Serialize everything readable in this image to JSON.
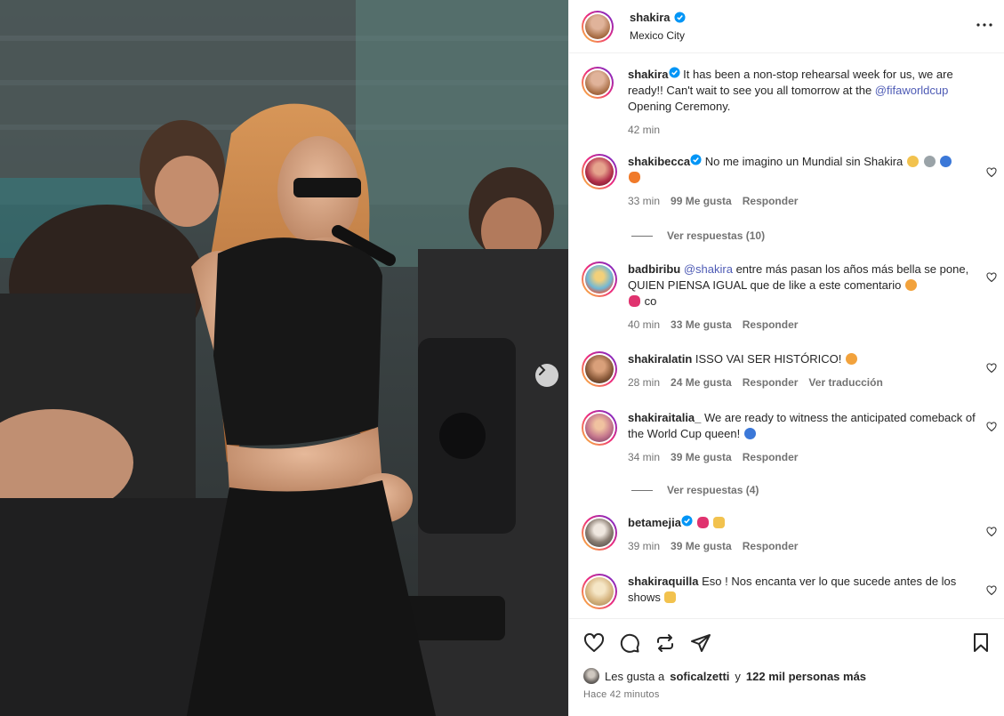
{
  "post": {
    "author": "shakira",
    "location": "Mexico City",
    "caption_text": "It has been a non-stop rehearsal week for us, we are ready!! Can't wait to see you all tomorrow at the",
    "caption_mention": "@fifaworldcup",
    "caption_end": "Opening Ceremony.",
    "caption_time": "42 min"
  },
  "comments": [
    {
      "user": "shakibecca",
      "verified": true,
      "text": "No me imagino un Mundial sin Shakira",
      "time": "33 min",
      "likes": "99 Me gusta",
      "reply": "Responder",
      "avatar_color": "#b2304a",
      "ring": true
    },
    {
      "user": "badbiribu",
      "verified": false,
      "mention": "@shakira",
      "text": "entre más pasan los años más bella se pone, QUIEN PIENSA IGUAL que de like a este comentario",
      "text_end": "co",
      "time": "40 min",
      "likes": "33 Me gusta",
      "reply": "Responder",
      "avatar_color": "#6fb7d6",
      "ring": true
    },
    {
      "user": "shakiralatin",
      "verified": false,
      "text": "ISSO VAI SER HISTÓRICO!",
      "time": "28 min",
      "likes": "24 Me gusta",
      "reply": "Responder",
      "translate": "Ver traducción",
      "avatar_color": "#8a5a3a",
      "ring": true
    },
    {
      "user": "shakiraitalia_",
      "verified": false,
      "text": "We are ready to witness the anticipated comeback of the World Cup queen!",
      "time": "34 min",
      "likes": "39 Me gusta",
      "reply": "Responder",
      "avatar_color": "#c77a8e",
      "ring": true
    },
    {
      "user": "betamejia",
      "verified": true,
      "text": "",
      "time": "39 min",
      "likes": "39 Me gusta",
      "reply": "Responder",
      "avatar_color": "#3d3a38",
      "ring": true
    },
    {
      "user": "shakiraquilla",
      "verified": false,
      "text": "Eso ! Nos encanta ver lo que sucede antes de los shows",
      "time": "",
      "likes": "",
      "reply": "",
      "avatar_color": "#d9b986",
      "ring": true
    }
  ],
  "view_replies": [
    "Ver respuestas (10)",
    "Ver respuestas (4)"
  ],
  "footer": {
    "liked_prefix": "Les gusta a",
    "liked_user": "soficalzetti",
    "liked_mid": "y",
    "liked_count": "122 mil personas más",
    "time_ago": "Hace 42 minutos"
  },
  "colors": {
    "verified_blue": "#0095f6",
    "mention": "#4e5bb5",
    "muted": "#737373"
  },
  "icons": [
    "heart-icon",
    "comment-icon",
    "share-icon",
    "send-icon",
    "bookmark-icon",
    "more-icon",
    "chevron-right-icon"
  ]
}
